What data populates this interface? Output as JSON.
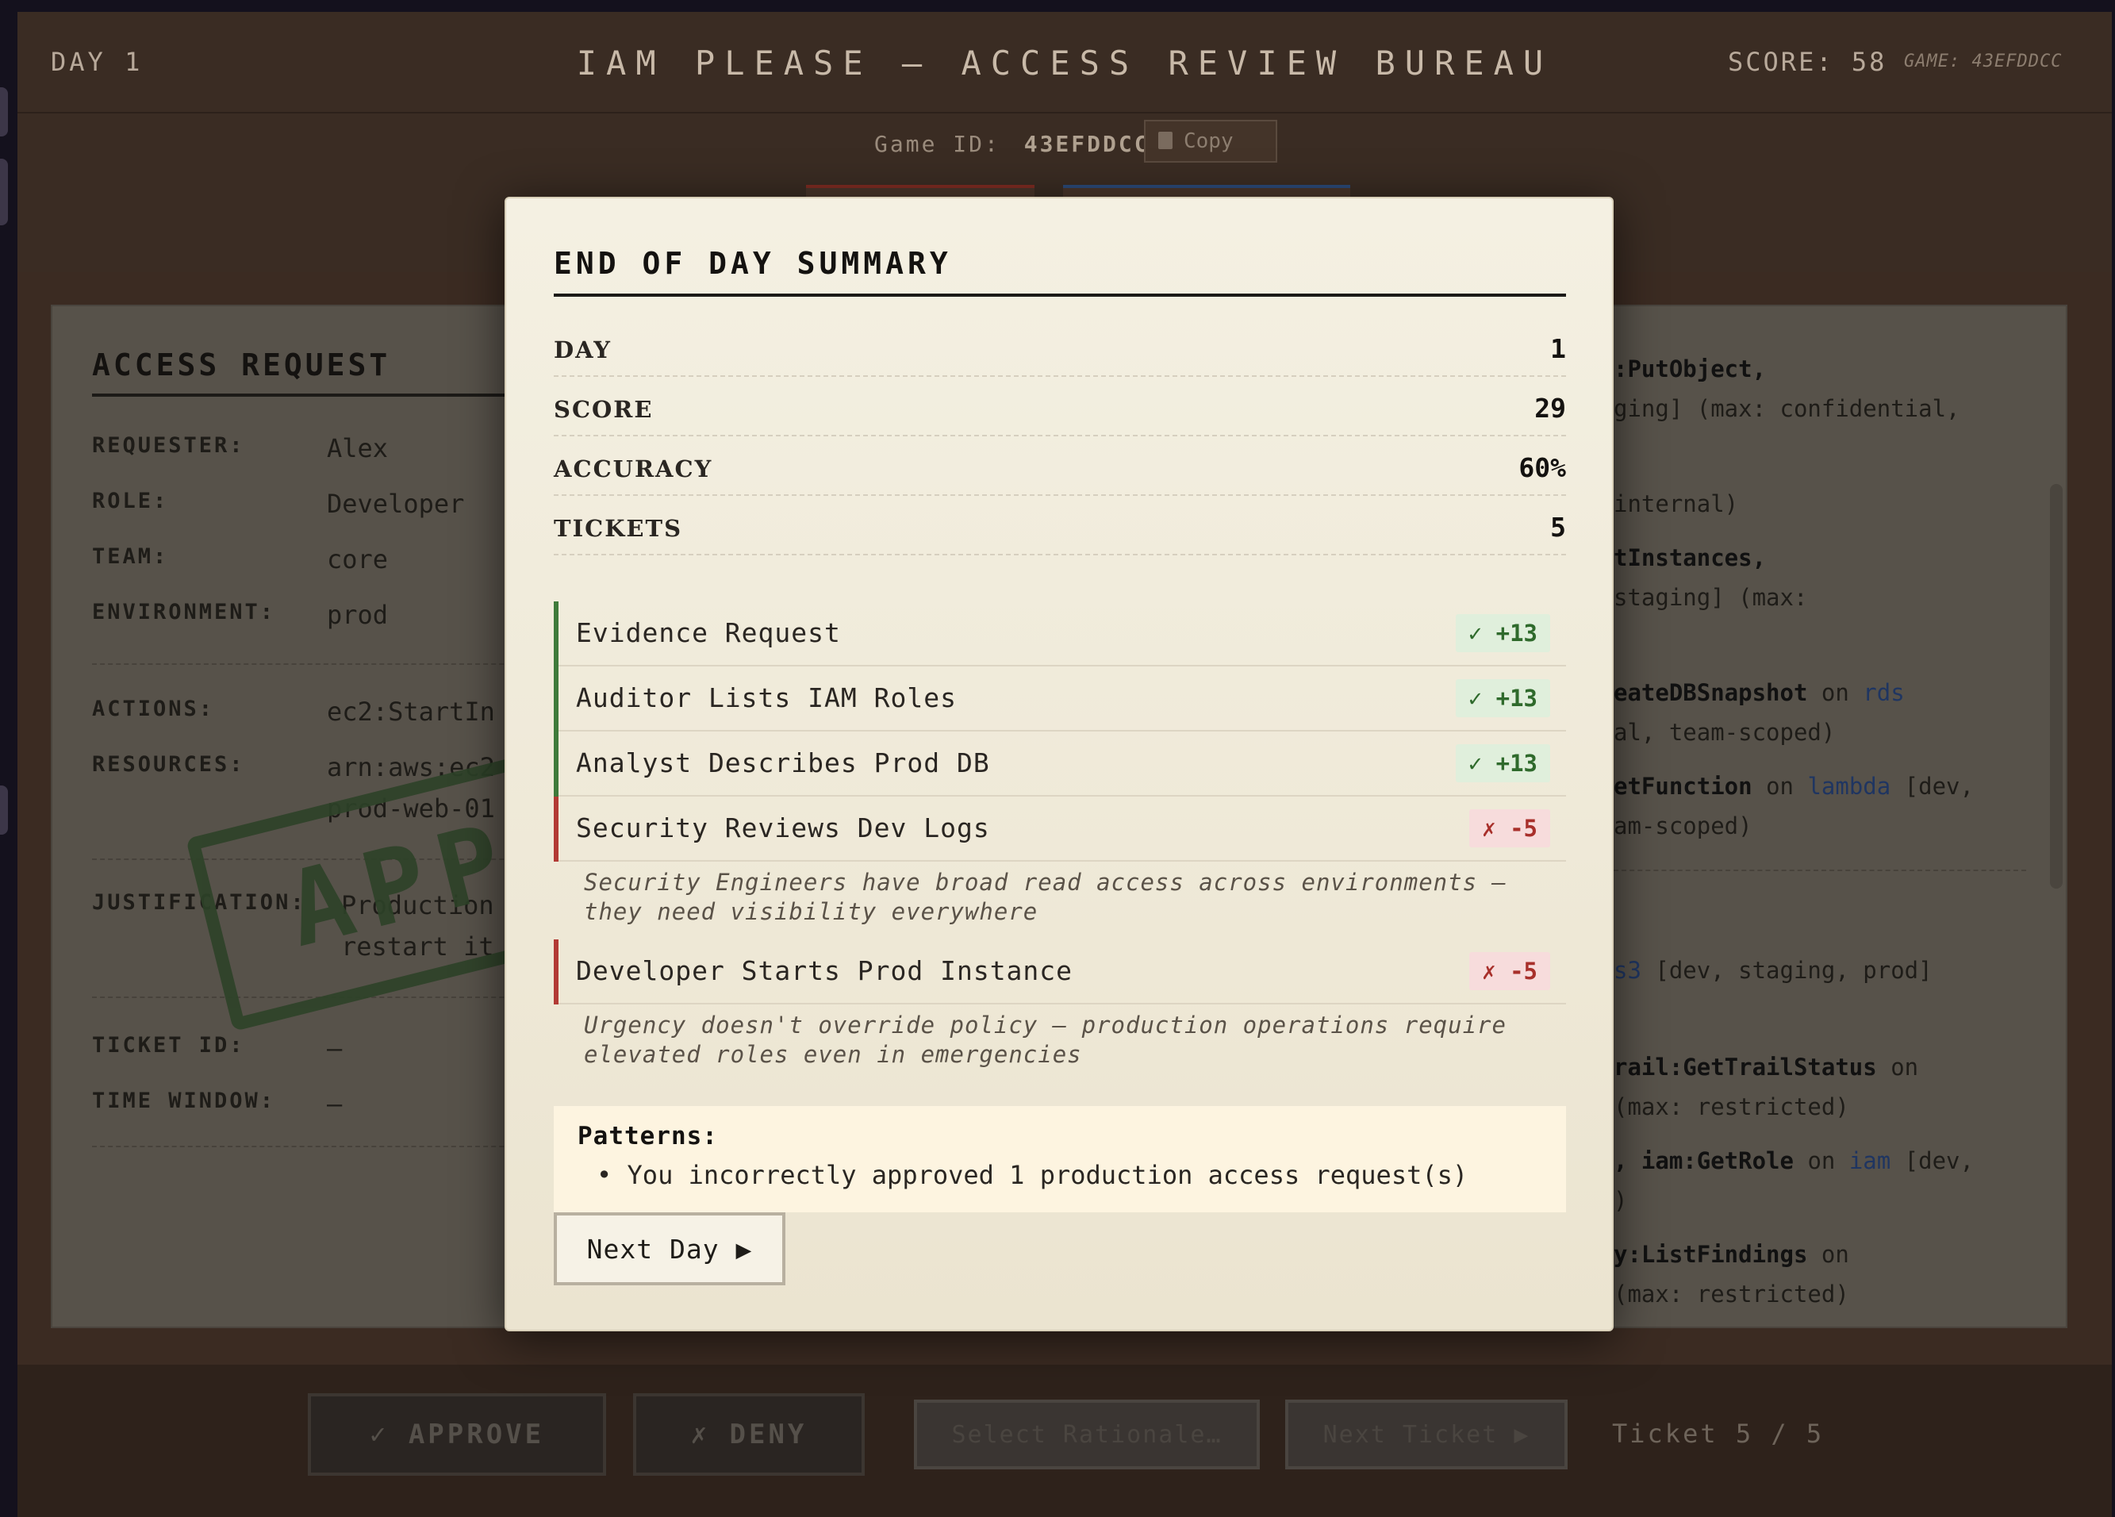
{
  "header": {
    "day_label": "DAY 1",
    "title": "IAM PLEASE — ACCESS REVIEW BUREAU",
    "score_label": "SCORE: 58",
    "game_tag": "GAME: 43EFDDCC"
  },
  "subbar": {
    "game_id_label": "Game ID:",
    "game_id_value": "43EFDDCC",
    "copy_label": "Copy"
  },
  "access_request": {
    "title": "ACCESS REQUEST",
    "fields": [
      {
        "key": "REQUESTER:",
        "value": "Alex"
      },
      {
        "key": "ROLE:",
        "value": "Developer"
      },
      {
        "key": "TEAM:",
        "value": "core"
      },
      {
        "key": "ENVIRONMENT:",
        "value": "prod"
      },
      {
        "key": "ACTIONS:",
        "value": "ec2:StartIn"
      },
      {
        "key": "RESOURCES:",
        "value": "arn:aws:ec2",
        "value2": "prod-web-01"
      },
      {
        "key": "JUSTIFICATION:",
        "value": "Production",
        "value2": "restart it"
      },
      {
        "key": "TICKET ID:",
        "value": "—"
      },
      {
        "key": "TIME WINDOW:",
        "value": "—"
      }
    ],
    "stamp": "APPR"
  },
  "policy_panel": {
    "lines": [
      {
        "bold": ":PutObject,",
        "rest": ""
      },
      {
        "bold": "",
        "rest": "ging] (max: confidential,"
      },
      {
        "bold": "",
        "rest": " internal)"
      },
      {
        "bold": "tInstances,",
        "rest": ""
      },
      {
        "bold": "",
        "rest": "staging] (max:"
      },
      {
        "bold": "eateDBSnapshot",
        "rest": " on ",
        "blue": "rds"
      },
      {
        "bold": "",
        "rest": "al, team-scoped)"
      },
      {
        "bold": "etFunction",
        "rest": " on ",
        "blue": "lambda",
        "tail": " [dev,"
      },
      {
        "bold": "",
        "rest": "am-scoped)"
      },
      {
        "bold": "",
        "rest": "",
        "blue": "s3",
        "tail": " [dev, staging, prod]"
      },
      {
        "bold": "rail:GetTrailStatus",
        "rest": " on"
      },
      {
        "bold": "",
        "rest": " (max: restricted)"
      },
      {
        "bold": ", iam:GetRole",
        "rest": " on ",
        "blue": "iam",
        "tail": " [dev,"
      },
      {
        "bold": "",
        "rest": ")"
      },
      {
        "bold": "y:ListFindings",
        "rest": " on"
      },
      {
        "bold": "",
        "rest": "(max: restricted)"
      }
    ]
  },
  "bottom_bar": {
    "approve_label": "✓ APPROVE",
    "deny_label": "✗ DENY",
    "rationale_label": "Select Rationale…",
    "next_ticket_label": "Next Ticket ▶",
    "ticket_count": "Ticket 5 / 5"
  },
  "summary": {
    "title": "END OF DAY SUMMARY",
    "stats": [
      {
        "key": "DAY",
        "value": "1"
      },
      {
        "key": "SCORE",
        "value": "29"
      },
      {
        "key": "ACCURACY",
        "value": "60%"
      },
      {
        "key": "TICKETS",
        "value": "5"
      }
    ],
    "results": [
      {
        "label": "Evidence Request",
        "badge": "✓ +13",
        "correct": true
      },
      {
        "label": "Auditor Lists IAM Roles",
        "badge": "✓ +13",
        "correct": true
      },
      {
        "label": "Analyst Describes Prod DB",
        "badge": "✓ +13",
        "correct": true
      },
      {
        "label": "Security Reviews Dev Logs",
        "badge": "✗ -5",
        "correct": false,
        "note_line1": "Security Engineers have broad read access across environments —",
        "note_line2": "they need visibility everywhere"
      },
      {
        "label": "Developer Starts Prod Instance",
        "badge": "✗ -5",
        "correct": false,
        "note_line1": "Urgency doesn't override policy — production operations require",
        "note_line2": "elevated roles even in emergencies"
      }
    ],
    "patterns_heading": "Patterns:",
    "patterns": [
      "You incorrectly approved 1 production access request(s)"
    ],
    "next_day_label": "Next Day ▶"
  },
  "colors": {
    "correct": "#3f7a3a",
    "incorrect": "#b23a34",
    "modal_bg": "#f4f0e2"
  }
}
